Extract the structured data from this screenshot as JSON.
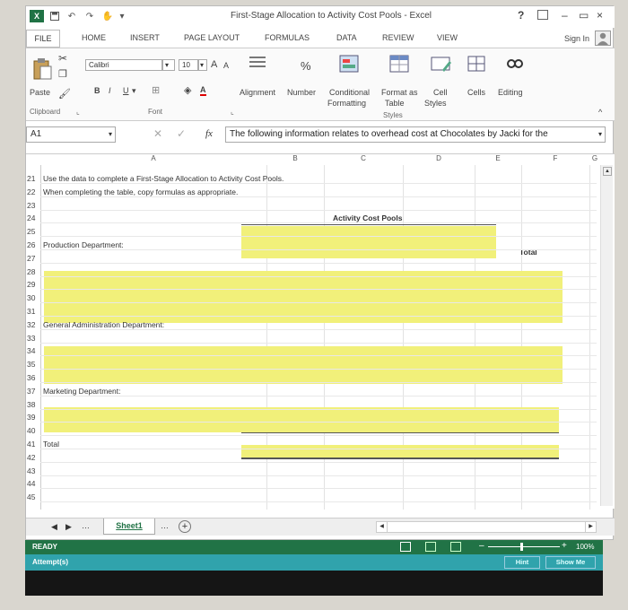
{
  "title": "First-Stage Allocation to Activity Cost Pools - Excel",
  "window_controls": {
    "help": "?",
    "minimize": "–",
    "restore": "▭",
    "close": "×"
  },
  "tabs": [
    "FILE",
    "HOME",
    "INSERT",
    "PAGE LAYOUT",
    "FORMULAS",
    "DATA",
    "REVIEW",
    "VIEW"
  ],
  "sign_in": "Sign In",
  "ribbon": {
    "paste": "Paste",
    "font_name": "Calibri",
    "font_size": "10",
    "bold": "B",
    "italic": "I",
    "underline": "U",
    "grow_font": "A",
    "shrink_font": "A",
    "font_color": "A",
    "alignment": "Alignment",
    "number": "Number",
    "percent": "%",
    "conditional": "Conditional",
    "formatting": "Formatting",
    "format_as": "Format as",
    "table": "Table",
    "cell": "Cell",
    "styles_btn": "Styles",
    "cells": "Cells",
    "editing": "Editing",
    "groups": {
      "clipboard": "Clipboard",
      "font": "Font",
      "styles": "Styles"
    }
  },
  "name_box": "A1",
  "formula_bar": "The following information relates to overhead cost at Chocolates by Jacki for the",
  "columns": [
    "A",
    "B",
    "C",
    "D",
    "E",
    "F",
    "G"
  ],
  "rows": [
    {
      "n": "21",
      "text": "Use the data to complete a First-Stage Allocation to Activity Cost Pools."
    },
    {
      "n": "22",
      "text": "When completing the table, copy formulas as appropriate."
    },
    {
      "n": "23",
      "text": ""
    },
    {
      "n": "24",
      "text": ""
    },
    {
      "n": "25",
      "text": ""
    },
    {
      "n": "26",
      "text": "Production Department:"
    },
    {
      "n": "27",
      "text": ""
    },
    {
      "n": "28",
      "text": ""
    },
    {
      "n": "29",
      "text": ""
    },
    {
      "n": "30",
      "text": ""
    },
    {
      "n": "31",
      "text": ""
    },
    {
      "n": "32",
      "text": "General Administration Department:"
    },
    {
      "n": "33",
      "text": ""
    },
    {
      "n": "34",
      "text": ""
    },
    {
      "n": "35",
      "text": ""
    },
    {
      "n": "36",
      "text": ""
    },
    {
      "n": "37",
      "text": "Marketing Department:"
    },
    {
      "n": "38",
      "text": ""
    },
    {
      "n": "39",
      "text": ""
    },
    {
      "n": "40",
      "text": ""
    },
    {
      "n": "41",
      "text": "Total"
    },
    {
      "n": "42",
      "text": ""
    },
    {
      "n": "43",
      "text": ""
    },
    {
      "n": "44",
      "text": ""
    },
    {
      "n": "45",
      "text": ""
    }
  ],
  "activity_cost_pools": "Activity Cost Pools",
  "total_header": "Total",
  "sheet_tab": "Sheet1",
  "status": {
    "ready": "READY",
    "zoom": "100%"
  },
  "attempt": {
    "label": "Attempt(s)",
    "hint": "Hint",
    "show_me": "Show Me"
  },
  "colors": {
    "excel_green": "#217346",
    "highlight": "#f1f07a",
    "teal": "#30a3ac"
  }
}
